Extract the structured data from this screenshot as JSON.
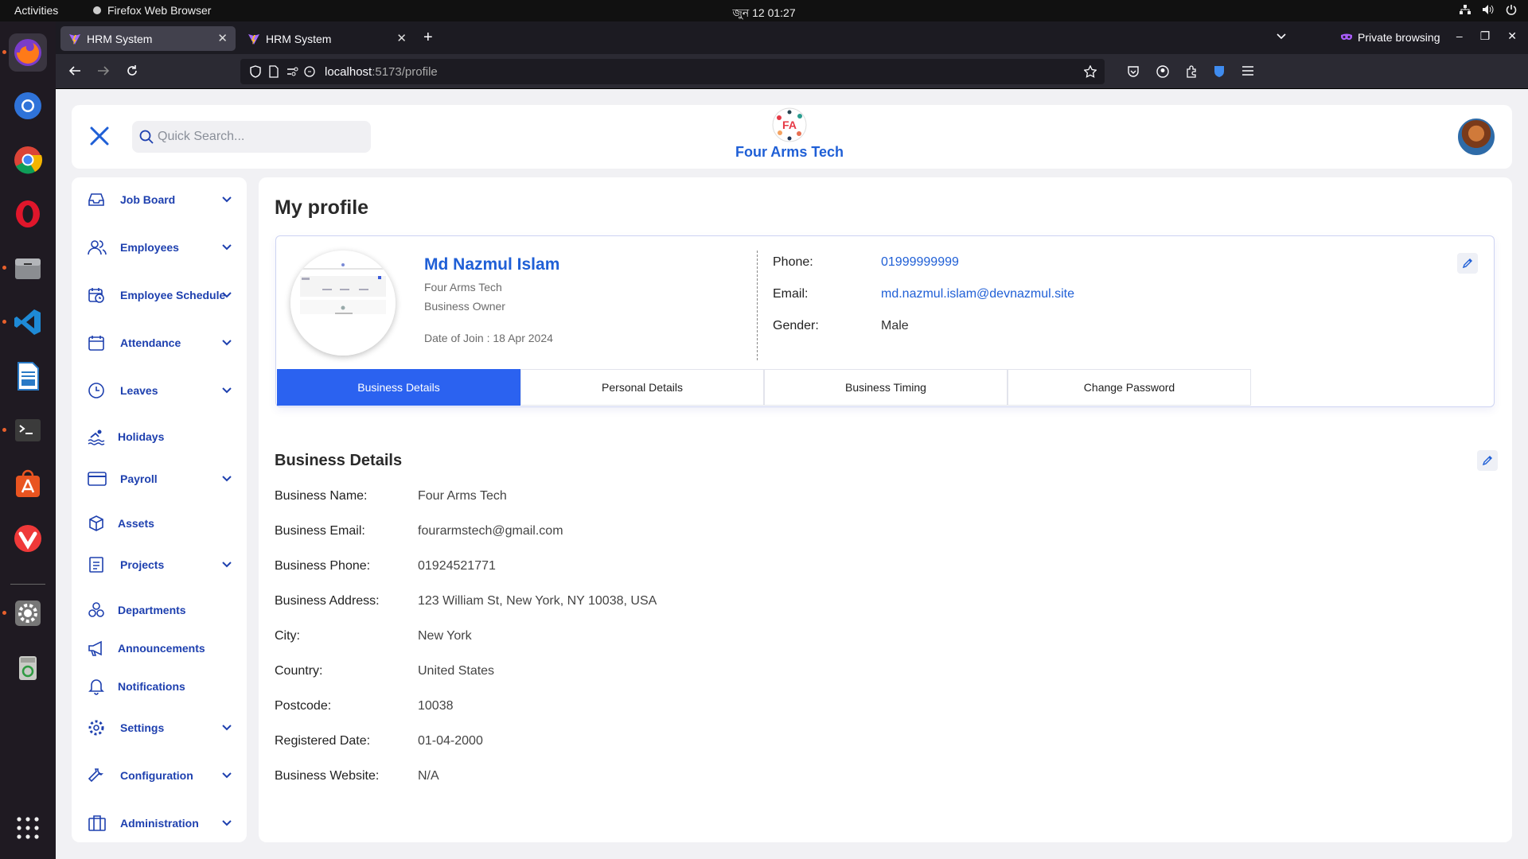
{
  "os": {
    "activities": "Activities",
    "app_name": "Firefox Web Browser",
    "clock": "জুন 12  01:27"
  },
  "browser": {
    "tabs": [
      {
        "title": "HRM System",
        "active": true
      },
      {
        "title": "HRM System",
        "active": false
      }
    ],
    "private_label": "Private browsing",
    "url_host": "localhost",
    "url_path": ":5173/profile"
  },
  "header": {
    "search_placeholder": "Quick Search...",
    "brand_name": "Four Arms Tech"
  },
  "sidebar": {
    "items": [
      {
        "label": "Job Board",
        "icon": "inbox-icon",
        "chevron": true
      },
      {
        "label": "Employees",
        "icon": "users-icon",
        "chevron": true
      },
      {
        "label": "Employee Schedule",
        "icon": "calendar-clock-icon",
        "chevron": true
      },
      {
        "label": "Attendance",
        "icon": "calendar-icon",
        "chevron": true
      },
      {
        "label": "Leaves",
        "icon": "clock-icon",
        "chevron": true
      },
      {
        "label": "Holidays",
        "icon": "swimmer-icon",
        "chevron": false
      },
      {
        "label": "Payroll",
        "icon": "credit-card-icon",
        "chevron": true
      },
      {
        "label": "Assets",
        "icon": "box-icon",
        "chevron": false
      },
      {
        "label": "Projects",
        "icon": "document-icon",
        "chevron": true
      },
      {
        "label": "Departments",
        "icon": "departments-icon",
        "chevron": false
      },
      {
        "label": "Announcements",
        "icon": "megaphone-icon",
        "chevron": false
      },
      {
        "label": "Notifications",
        "icon": "bell-icon",
        "chevron": false
      },
      {
        "label": "Settings",
        "icon": "gear-icon",
        "chevron": true
      },
      {
        "label": "Configuration",
        "icon": "wrench-icon",
        "chevron": true
      },
      {
        "label": "Administration",
        "icon": "building-icon",
        "chevron": true
      }
    ]
  },
  "main": {
    "title": "My profile",
    "profile": {
      "name": "Md Nazmul Islam",
      "company": "Four Arms Tech",
      "role": "Business Owner",
      "date_of_join": "Date of Join : 18 Apr 2024",
      "phone_label": "Phone:",
      "phone": "01999999999",
      "email_label": "Email:",
      "email": "md.nazmul.islam@devnazmul.site",
      "gender_label": "Gender:",
      "gender": "Male"
    },
    "tabs": [
      "Business Details",
      "Personal Details",
      "Business Timing",
      "Change Password"
    ],
    "active_tab": 0,
    "details_title": "Business Details",
    "details": [
      {
        "label": "Business Name:",
        "value": "Four Arms Tech"
      },
      {
        "label": "Business Email:",
        "value": "fourarmstech@gmail.com"
      },
      {
        "label": "Business Phone:",
        "value": "01924521771"
      },
      {
        "label": "Business Address:",
        "value": "123 William St, New York, NY 10038, USA"
      },
      {
        "label": "City:",
        "value": "New York"
      },
      {
        "label": "Country:",
        "value": "United States"
      },
      {
        "label": "Postcode:",
        "value": "10038"
      },
      {
        "label": "Registered Date:",
        "value": "01-04-2000"
      },
      {
        "label": "Business Website:",
        "value": "N/A"
      }
    ]
  },
  "colors": {
    "accent": "#2b62f0",
    "link": "#1f5fd6",
    "nav_text": "#1e40af"
  }
}
